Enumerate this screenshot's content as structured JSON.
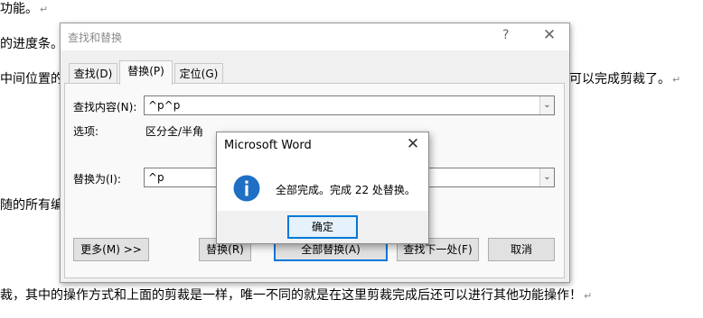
{
  "document": {
    "lines": [
      "功能。",
      "的进度条。",
      "中间位置的",
      "可以完成剪裁了。",
      "随的所有编",
      "裁，其中的操作方式和上面的剪裁是一样，唯一不同的就是在这里剪裁完成后还可以进行其他功能操作！"
    ],
    "paragraph_mark": "↵"
  },
  "find_replace": {
    "title": "查找和替换",
    "help_glyph": "?",
    "close_glyph": "✕",
    "tabs": [
      "查找(D)",
      "替换(P)",
      "定位(G)"
    ],
    "active_tab": "替换(P)",
    "find_label": "查找内容(N):",
    "find_value": "^p^p",
    "options_label": "选项:",
    "options_value": "区分全/半角",
    "replace_label": "替换为(I):",
    "replace_value": "^p",
    "more_button": "更多(M) >>",
    "replace_button": "替换(R)",
    "replace_all_button": "全部替换(A)",
    "find_next_button": "查找下一处(F)",
    "cancel_button": "取消",
    "dropdown_glyph": "⌄"
  },
  "message_box": {
    "title": "Microsoft Word",
    "close_glyph": "✕",
    "icon": "info-icon",
    "icon_glyph": "i",
    "message": "全部完成。完成 22 处替换。",
    "ok_button": "确定",
    "accent_color": "#1f6fc5"
  }
}
